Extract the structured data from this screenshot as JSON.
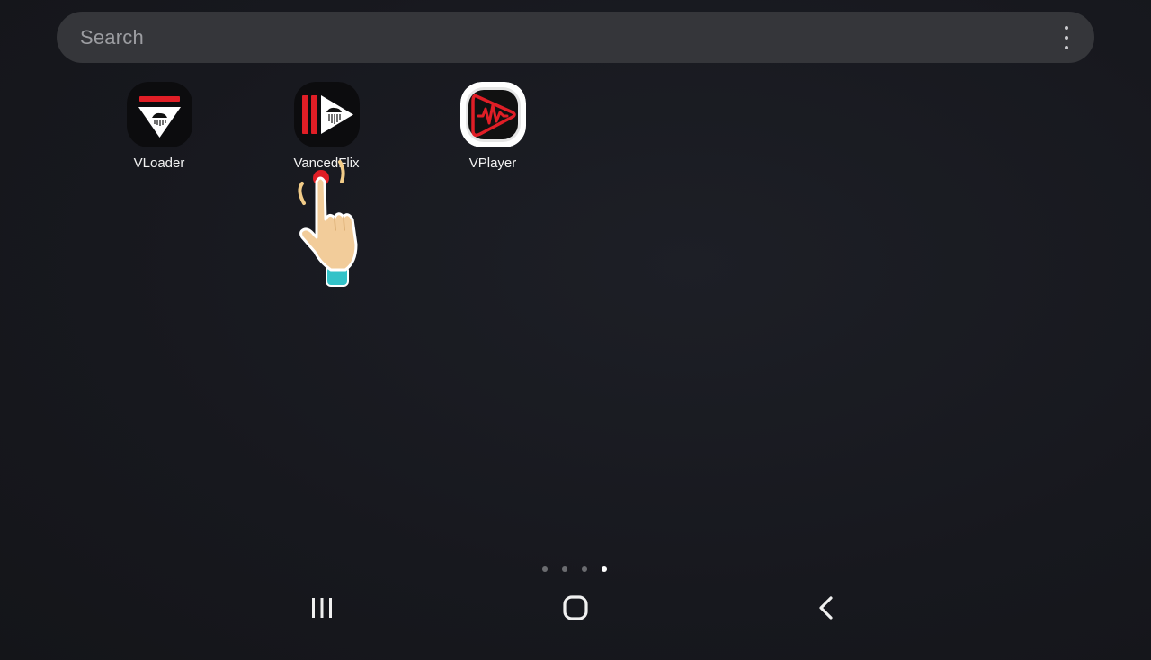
{
  "search": {
    "placeholder": "Search",
    "menu_icon": "more-vertical-icon"
  },
  "apps": [
    {
      "label": "VLoader",
      "icon": "vloader-app-icon"
    },
    {
      "label": "VancedFlix",
      "icon": "vancedflix-app-icon"
    },
    {
      "label": "VPlayer",
      "icon": "vplayer-app-icon"
    }
  ],
  "page_indicator": {
    "count": 4,
    "active_index": 3
  },
  "nav_bar": {
    "recents_icon": "recents-icon",
    "home_icon": "home-icon",
    "back_icon": "back-icon"
  },
  "overlay": {
    "pointer_icon": "tap-hand-icon"
  },
  "colors": {
    "background": "#17181e",
    "search_bar": "#35363a",
    "brand_red": "#e01e26"
  }
}
